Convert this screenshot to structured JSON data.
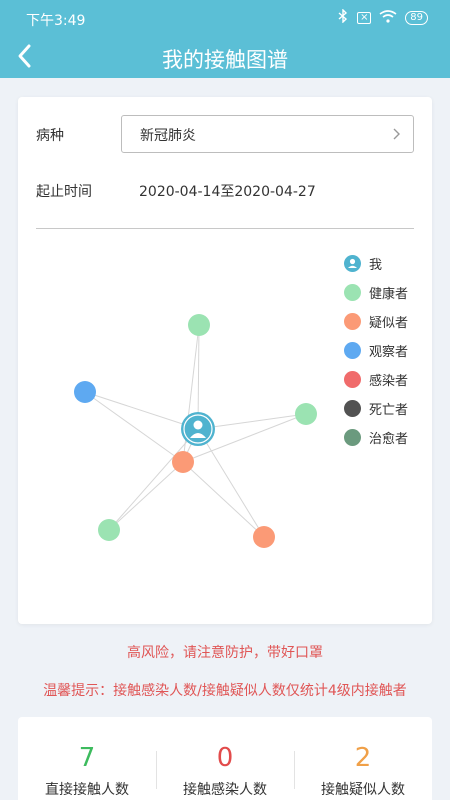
{
  "statusbar": {
    "time": "下午3:49",
    "battery": "89"
  },
  "nav": {
    "title": "我的接触图谱"
  },
  "filter": {
    "disease_label": "病种",
    "disease_value": "新冠肺炎",
    "period_label": "起止时间",
    "period_value": "2020-04-14至2020-04-27"
  },
  "legend": [
    {
      "label": "我",
      "color": "#4fb3cf",
      "icon": "user-icon"
    },
    {
      "label": "健康者",
      "color": "#9be3b2"
    },
    {
      "label": "疑似者",
      "color": "#fb9a76"
    },
    {
      "label": "观察者",
      "color": "#5ea9f1"
    },
    {
      "label": "感染者",
      "color": "#f06b6b"
    },
    {
      "label": "死亡者",
      "color": "#525252"
    },
    {
      "label": "治愈者",
      "color": "#6b9a7e"
    }
  ],
  "graph": {
    "edge_color": "#d6d6d6",
    "nodes": [
      {
        "id": "me",
        "type": "我"
      },
      {
        "id": "n1",
        "type": "健康者"
      },
      {
        "id": "n2",
        "type": "观察者"
      },
      {
        "id": "n3",
        "type": "健康者"
      },
      {
        "id": "n4",
        "type": "疑似者"
      },
      {
        "id": "n5",
        "type": "健康者"
      },
      {
        "id": "n6",
        "type": "疑似者"
      }
    ],
    "links": [
      [
        "me",
        "n1"
      ],
      [
        "me",
        "n2"
      ],
      [
        "me",
        "n3"
      ],
      [
        "me",
        "n4"
      ],
      [
        "me",
        "n5"
      ],
      [
        "me",
        "n6"
      ],
      [
        "n4",
        "n2"
      ],
      [
        "n4",
        "n1"
      ],
      [
        "n4",
        "n3"
      ],
      [
        "n4",
        "n5"
      ],
      [
        "n4",
        "n6"
      ]
    ]
  },
  "warnings": {
    "risk": "高风险，请注意防护，带好口罩",
    "tip": "温馨提示：接触感染人数/接触疑似人数仅统计4级内接触者"
  },
  "stats": [
    {
      "value": "7",
      "label": "直接接触人数",
      "color": "#3dbb5e"
    },
    {
      "value": "0",
      "label": "接触感染人数",
      "color": "#e24b4b"
    },
    {
      "value": "2",
      "label": "接触疑似人数",
      "color": "#f0a048"
    }
  ]
}
